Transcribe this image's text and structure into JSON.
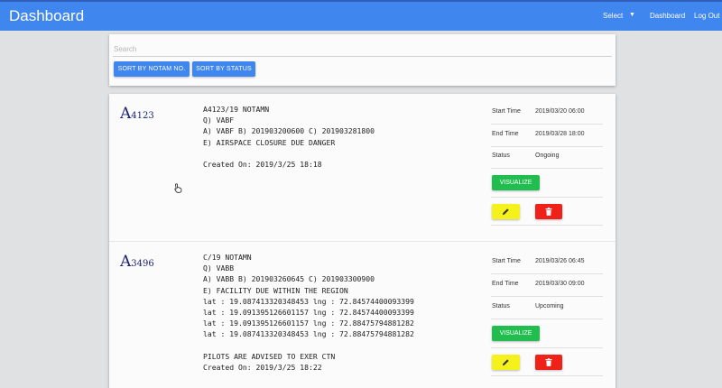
{
  "app": {
    "title": "Dashboard"
  },
  "nav": {
    "select_label": "Select",
    "dashboard_label": "Dashboard",
    "logout_label": "Log Out"
  },
  "search": {
    "placeholder": "Search",
    "value": ""
  },
  "sort": {
    "by_number": "SORT BY NOTAM NO.",
    "by_status": "SORT BY STATUS"
  },
  "labels": {
    "start_time": "Start Time",
    "end_time": "End Time",
    "status": "Status",
    "visualize": "VISUALIZE"
  },
  "colors": {
    "primary": "#3f86ee",
    "visualize": "#22bd4f",
    "edit": "#f4f11b",
    "delete": "#ef2118",
    "notam_id": "#1b2270"
  },
  "icons": {
    "edit": "pencil-icon",
    "delete": "trash-icon",
    "sort_select": "caret-down-icon"
  },
  "notams": [
    {
      "series": "A",
      "number": "4123",
      "lines": [
        "A4123/19 NOTAMN",
        "Q) VABF",
        "A) VABF B) 201903200600 C) 201903281800",
        "E) AIRSPACE CLOSURE DUE DANGER",
        "",
        "Created On: 2019/3/25 18:18"
      ],
      "start_time": "2019/03/20 06:00",
      "end_time": "2019/03/28 18:00",
      "status": "Ongoing"
    },
    {
      "series": "A",
      "number": "3496",
      "lines": [
        "C/19 NOTAMN",
        "Q) VABB",
        "A) VABB B) 201903260645 C) 201903300900",
        "E) FACILITY DUE WITHIN THE REGION",
        "lat : 19.087413320348453 lng : 72.84574400093399",
        "lat : 19.091395126601157 lng : 72.84574400093399",
        "lat : 19.091395126601157 lng : 72.88475794881282",
        "lat : 19.087413320348453 lng : 72.88475794881282",
        "",
        "PILOTS ARE ADVISED TO EXER CTN",
        "Created On: 2019/3/25 18:22"
      ],
      "start_time": "2019/03/26 06:45",
      "end_time": "2019/03/30 09:00",
      "status": "Upcoming"
    }
  ]
}
